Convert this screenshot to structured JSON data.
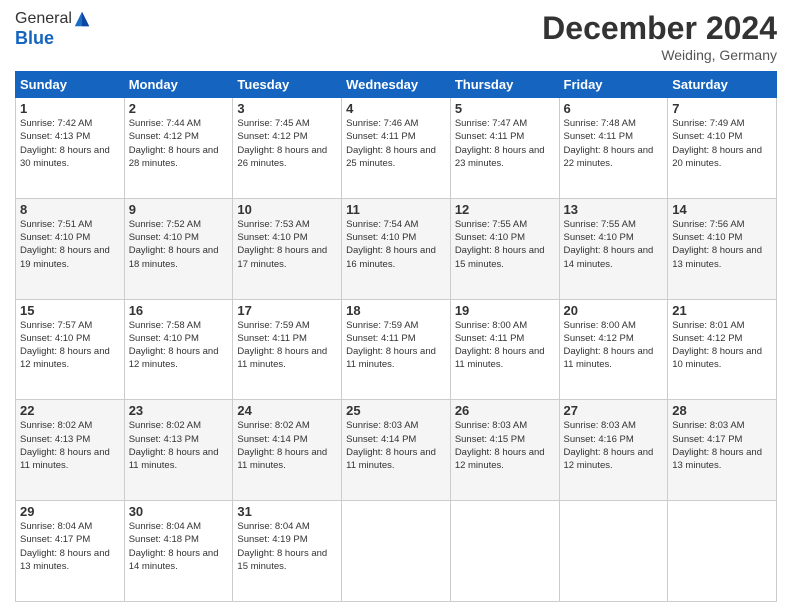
{
  "logo": {
    "general": "General",
    "blue": "Blue"
  },
  "header": {
    "month": "December 2024",
    "location": "Weiding, Germany"
  },
  "weekdays": [
    "Sunday",
    "Monday",
    "Tuesday",
    "Wednesday",
    "Thursday",
    "Friday",
    "Saturday"
  ],
  "weeks": [
    [
      {
        "day": "1",
        "sunrise": "7:42 AM",
        "sunset": "4:13 PM",
        "daylight": "8 hours and 30 minutes."
      },
      {
        "day": "2",
        "sunrise": "7:44 AM",
        "sunset": "4:12 PM",
        "daylight": "8 hours and 28 minutes."
      },
      {
        "day": "3",
        "sunrise": "7:45 AM",
        "sunset": "4:12 PM",
        "daylight": "8 hours and 26 minutes."
      },
      {
        "day": "4",
        "sunrise": "7:46 AM",
        "sunset": "4:11 PM",
        "daylight": "8 hours and 25 minutes."
      },
      {
        "day": "5",
        "sunrise": "7:47 AM",
        "sunset": "4:11 PM",
        "daylight": "8 hours and 23 minutes."
      },
      {
        "day": "6",
        "sunrise": "7:48 AM",
        "sunset": "4:11 PM",
        "daylight": "8 hours and 22 minutes."
      },
      {
        "day": "7",
        "sunrise": "7:49 AM",
        "sunset": "4:10 PM",
        "daylight": "8 hours and 20 minutes."
      }
    ],
    [
      {
        "day": "8",
        "sunrise": "7:51 AM",
        "sunset": "4:10 PM",
        "daylight": "8 hours and 19 minutes."
      },
      {
        "day": "9",
        "sunrise": "7:52 AM",
        "sunset": "4:10 PM",
        "daylight": "8 hours and 18 minutes."
      },
      {
        "day": "10",
        "sunrise": "7:53 AM",
        "sunset": "4:10 PM",
        "daylight": "8 hours and 17 minutes."
      },
      {
        "day": "11",
        "sunrise": "7:54 AM",
        "sunset": "4:10 PM",
        "daylight": "8 hours and 16 minutes."
      },
      {
        "day": "12",
        "sunrise": "7:55 AM",
        "sunset": "4:10 PM",
        "daylight": "8 hours and 15 minutes."
      },
      {
        "day": "13",
        "sunrise": "7:55 AM",
        "sunset": "4:10 PM",
        "daylight": "8 hours and 14 minutes."
      },
      {
        "day": "14",
        "sunrise": "7:56 AM",
        "sunset": "4:10 PM",
        "daylight": "8 hours and 13 minutes."
      }
    ],
    [
      {
        "day": "15",
        "sunrise": "7:57 AM",
        "sunset": "4:10 PM",
        "daylight": "8 hours and 12 minutes."
      },
      {
        "day": "16",
        "sunrise": "7:58 AM",
        "sunset": "4:10 PM",
        "daylight": "8 hours and 12 minutes."
      },
      {
        "day": "17",
        "sunrise": "7:59 AM",
        "sunset": "4:11 PM",
        "daylight": "8 hours and 11 minutes."
      },
      {
        "day": "18",
        "sunrise": "7:59 AM",
        "sunset": "4:11 PM",
        "daylight": "8 hours and 11 minutes."
      },
      {
        "day": "19",
        "sunrise": "8:00 AM",
        "sunset": "4:11 PM",
        "daylight": "8 hours and 11 minutes."
      },
      {
        "day": "20",
        "sunrise": "8:00 AM",
        "sunset": "4:12 PM",
        "daylight": "8 hours and 11 minutes."
      },
      {
        "day": "21",
        "sunrise": "8:01 AM",
        "sunset": "4:12 PM",
        "daylight": "8 hours and 10 minutes."
      }
    ],
    [
      {
        "day": "22",
        "sunrise": "8:02 AM",
        "sunset": "4:13 PM",
        "daylight": "8 hours and 11 minutes."
      },
      {
        "day": "23",
        "sunrise": "8:02 AM",
        "sunset": "4:13 PM",
        "daylight": "8 hours and 11 minutes."
      },
      {
        "day": "24",
        "sunrise": "8:02 AM",
        "sunset": "4:14 PM",
        "daylight": "8 hours and 11 minutes."
      },
      {
        "day": "25",
        "sunrise": "8:03 AM",
        "sunset": "4:14 PM",
        "daylight": "8 hours and 11 minutes."
      },
      {
        "day": "26",
        "sunrise": "8:03 AM",
        "sunset": "4:15 PM",
        "daylight": "8 hours and 12 minutes."
      },
      {
        "day": "27",
        "sunrise": "8:03 AM",
        "sunset": "4:16 PM",
        "daylight": "8 hours and 12 minutes."
      },
      {
        "day": "28",
        "sunrise": "8:03 AM",
        "sunset": "4:17 PM",
        "daylight": "8 hours and 13 minutes."
      }
    ],
    [
      {
        "day": "29",
        "sunrise": "8:04 AM",
        "sunset": "4:17 PM",
        "daylight": "8 hours and 13 minutes."
      },
      {
        "day": "30",
        "sunrise": "8:04 AM",
        "sunset": "4:18 PM",
        "daylight": "8 hours and 14 minutes."
      },
      {
        "day": "31",
        "sunrise": "8:04 AM",
        "sunset": "4:19 PM",
        "daylight": "8 hours and 15 minutes."
      },
      null,
      null,
      null,
      null
    ]
  ]
}
